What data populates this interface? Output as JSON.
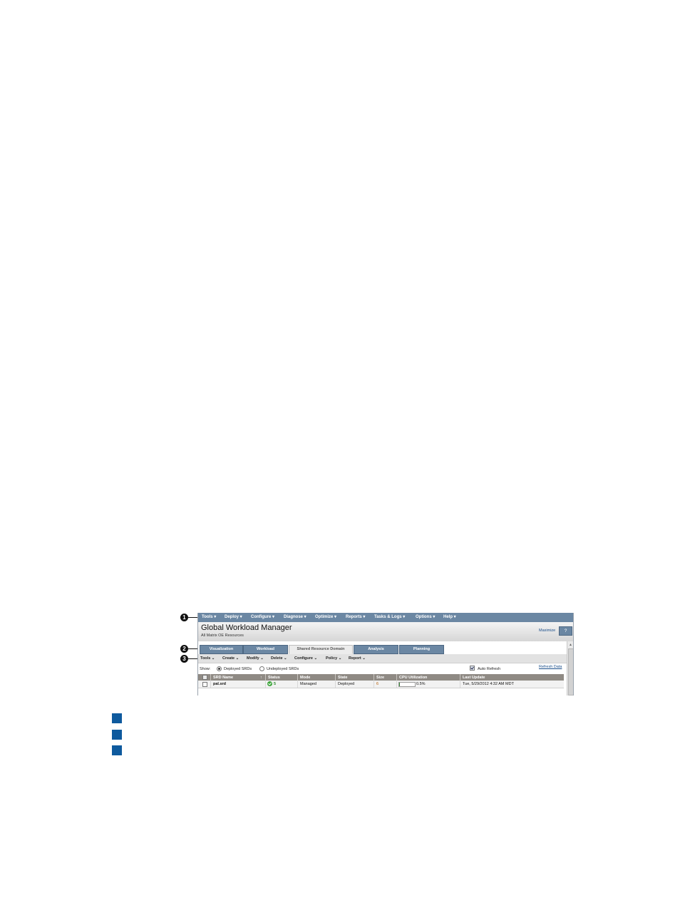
{
  "callouts": [
    "1",
    "2",
    "3"
  ],
  "menubar": {
    "items": [
      "Tools ▾",
      "Deploy ▾",
      "Configure ▾",
      "Diagnose ▾",
      "Optimize ▾",
      "Reports ▾",
      "Tasks & Logs ▾",
      "Options ▾",
      "Help ▾"
    ]
  },
  "header": {
    "title": "Global Workload Manager",
    "subtitle": "All Matrix OE Resources",
    "maximize": "Maximize",
    "help": "?"
  },
  "tabs": [
    {
      "label": "Visualization",
      "active": false
    },
    {
      "label": "Workload",
      "active": false
    },
    {
      "label": "Shared Resource Domain",
      "active": true
    },
    {
      "label": "Analysis",
      "active": false
    },
    {
      "label": "Planning",
      "active": false
    }
  ],
  "toolbar": {
    "items": [
      "Tools ⌄",
      "Create ⌄",
      "Modify ⌄",
      "Delete ⌄",
      "Configure ⌄",
      "Policy ⌄",
      "Report ⌄"
    ]
  },
  "show": {
    "label": "Show:",
    "deployed": "Deployed SRDs",
    "undeployed": "Undeployed SRDs",
    "deployed_selected": true,
    "auto_refresh": "Auto Refresh",
    "auto_refresh_checked": true,
    "refresh_link": "Refresh Data"
  },
  "table": {
    "columns": [
      "SRD Name",
      "↑",
      "Status",
      "Mode",
      "State",
      "Size",
      "CPU Utilization",
      "Last Update"
    ],
    "rows": [
      {
        "name": "pal.srd",
        "status": "5",
        "mode": "Managed",
        "state": "Deployed",
        "size": "6",
        "cpu": "0.5%",
        "cpu_fraction": 0.005,
        "last_update": "Tue, 5/29/2012 4:32 AM MDT"
      }
    ]
  },
  "colors": {
    "menubar": "#6b87a3",
    "legend_square": "#0e5a9e",
    "status_ok": "#3da43b",
    "table_header": "#8f8a84"
  }
}
